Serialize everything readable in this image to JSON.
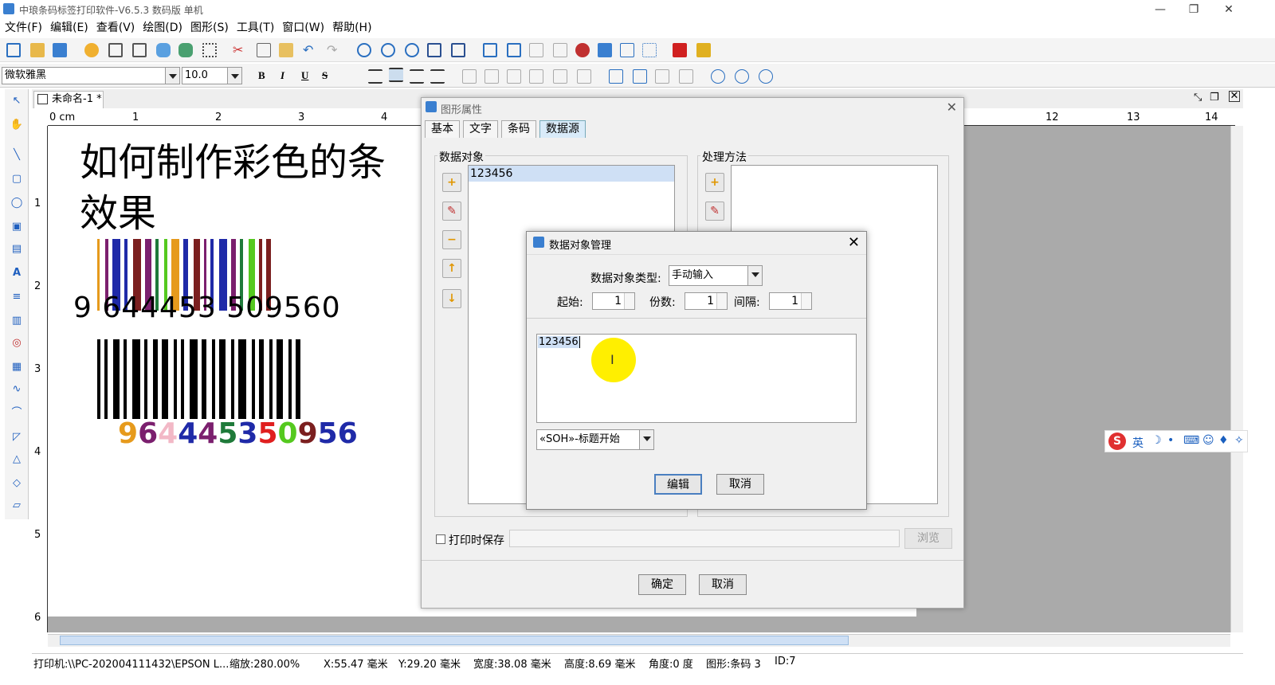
{
  "title": "中琅条码标签打印软件-V6.5.3 数码版 单机",
  "menu": [
    "文件(F)",
    "编辑(E)",
    "查看(V)",
    "绘图(D)",
    "图形(S)",
    "工具(T)",
    "窗口(W)",
    "帮助(H)"
  ],
  "font_name": "微软雅黑",
  "font_size": "10.0",
  "format_buttons": [
    "B",
    "I",
    "U",
    "S"
  ],
  "doc_tab": "未命名-1 *",
  "ruler_unit": "0 cm",
  "ruler_ticks": [
    "1",
    "2",
    "3",
    "4",
    "12",
    "13",
    "14"
  ],
  "vruler_ticks": [
    "1",
    "2",
    "3",
    "4",
    "5",
    "6"
  ],
  "canvas": {
    "heading": "如何制作彩色的条码效果",
    "heading_line1": "如何制作彩色的条",
    "heading_line2": "效果",
    "barcode1_digits": "9 644453 509560",
    "barcode2_digits": [
      "9",
      "6",
      "4",
      "4",
      "4",
      "5",
      "3",
      "5",
      "0",
      "9",
      "5",
      "6"
    ],
    "barcode2_colors": [
      "#e69a1c",
      "#7b1f6e",
      "#f2b8c6",
      "#1f2aa8",
      "#7b1f6e",
      "#1f7a3a",
      "#1f2aa8",
      "#e01f1f",
      "#55c91f",
      "#7b1f1f",
      "#1f2aa8",
      "#1f2aa8"
    ]
  },
  "dialog_props": {
    "title": "图形属性",
    "tabs": [
      "基本",
      "文字",
      "条码",
      "数据源"
    ],
    "data_objects_label": "数据对象",
    "data_objects": [
      "123456"
    ],
    "process_label": "处理方法",
    "save_on_print": "打印时保存",
    "browse": "浏览",
    "ok": "确定",
    "cancel": "取消"
  },
  "dialog_data": {
    "title": "数据对象管理",
    "type_label": "数据对象类型:",
    "type_value": "手动输入",
    "start_label": "起始:",
    "start_value": "1",
    "copies_label": "份数:",
    "copies_value": "1",
    "interval_label": "间隔:",
    "interval_value": "1",
    "content": "123456",
    "special_char": "«SOH»-标题开始",
    "edit": "编辑",
    "cancel": "取消"
  },
  "status": {
    "printer": "打印机:\\\\PC-202004111432\\EPSON L...",
    "zoom": "缩放:280.00%",
    "x": "X:55.47 毫米",
    "y": "Y:29.20 毫米",
    "width": "宽度:38.08 毫米",
    "height": "高度:8.69 毫米",
    "angle": "角度:0 度",
    "shape": "图形:条码 3",
    "id": "ID:7"
  },
  "ime": {
    "lang": "英"
  }
}
